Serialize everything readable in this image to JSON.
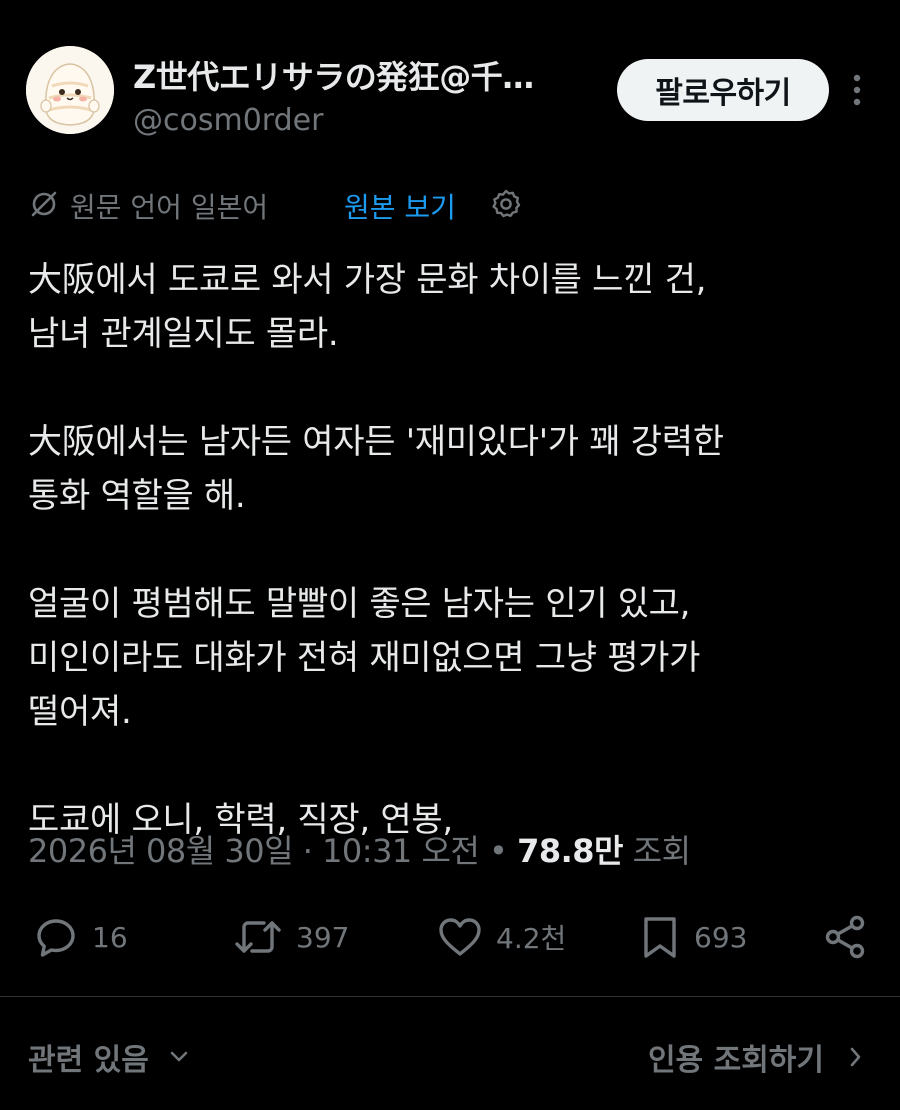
{
  "author": {
    "display_name": "Z世代エリサラの発狂@千…",
    "handle": "@cosm0rder",
    "avatar": "chibi-character-avatar"
  },
  "header": {
    "follow_label": "팔로우하기",
    "more_icon": "more-vertical-icon"
  },
  "translation": {
    "notice": "원문 언어 일본어",
    "show_original": "원본 보기",
    "translate_icon": "translate-icon",
    "settings_icon": "gear-icon",
    "link_color": "#1d9bf0"
  },
  "post": {
    "paragraphs": [
      "大阪에서 도쿄로 와서 가장 문화 차이를 느낀 건,\n남녀 관계일지도 몰라.",
      "大阪에서는 남자든 여자든 '재미있다'가 꽤 강력한\n통화 역할을 해.",
      "얼굴이 평범해도 말빨이 좋은 남자는 인기 있고,\n미인이라도 대화가 전혀 재미없으면 그냥 평가가\n떨어져.",
      "도쿄에 오니, 학력, 직장, 연봉,"
    ]
  },
  "meta": {
    "date": "2026년 08월 30일",
    "separator": "·",
    "time": "10:31 오전",
    "dot": "•",
    "views": "78.8만",
    "views_label": "조회"
  },
  "actions": {
    "reply_count": "16",
    "repost_count": "397",
    "like_count": "4.2천",
    "bookmark_count": "693"
  },
  "footer": {
    "related_label": "관련 있음",
    "quotes_label": "인용 조회하기"
  },
  "colors": {
    "background": "#000000",
    "text_primary": "#e7e9ea",
    "text_secondary": "#71767b",
    "divider": "#2f3336",
    "follow_bg": "#eff3f4"
  }
}
